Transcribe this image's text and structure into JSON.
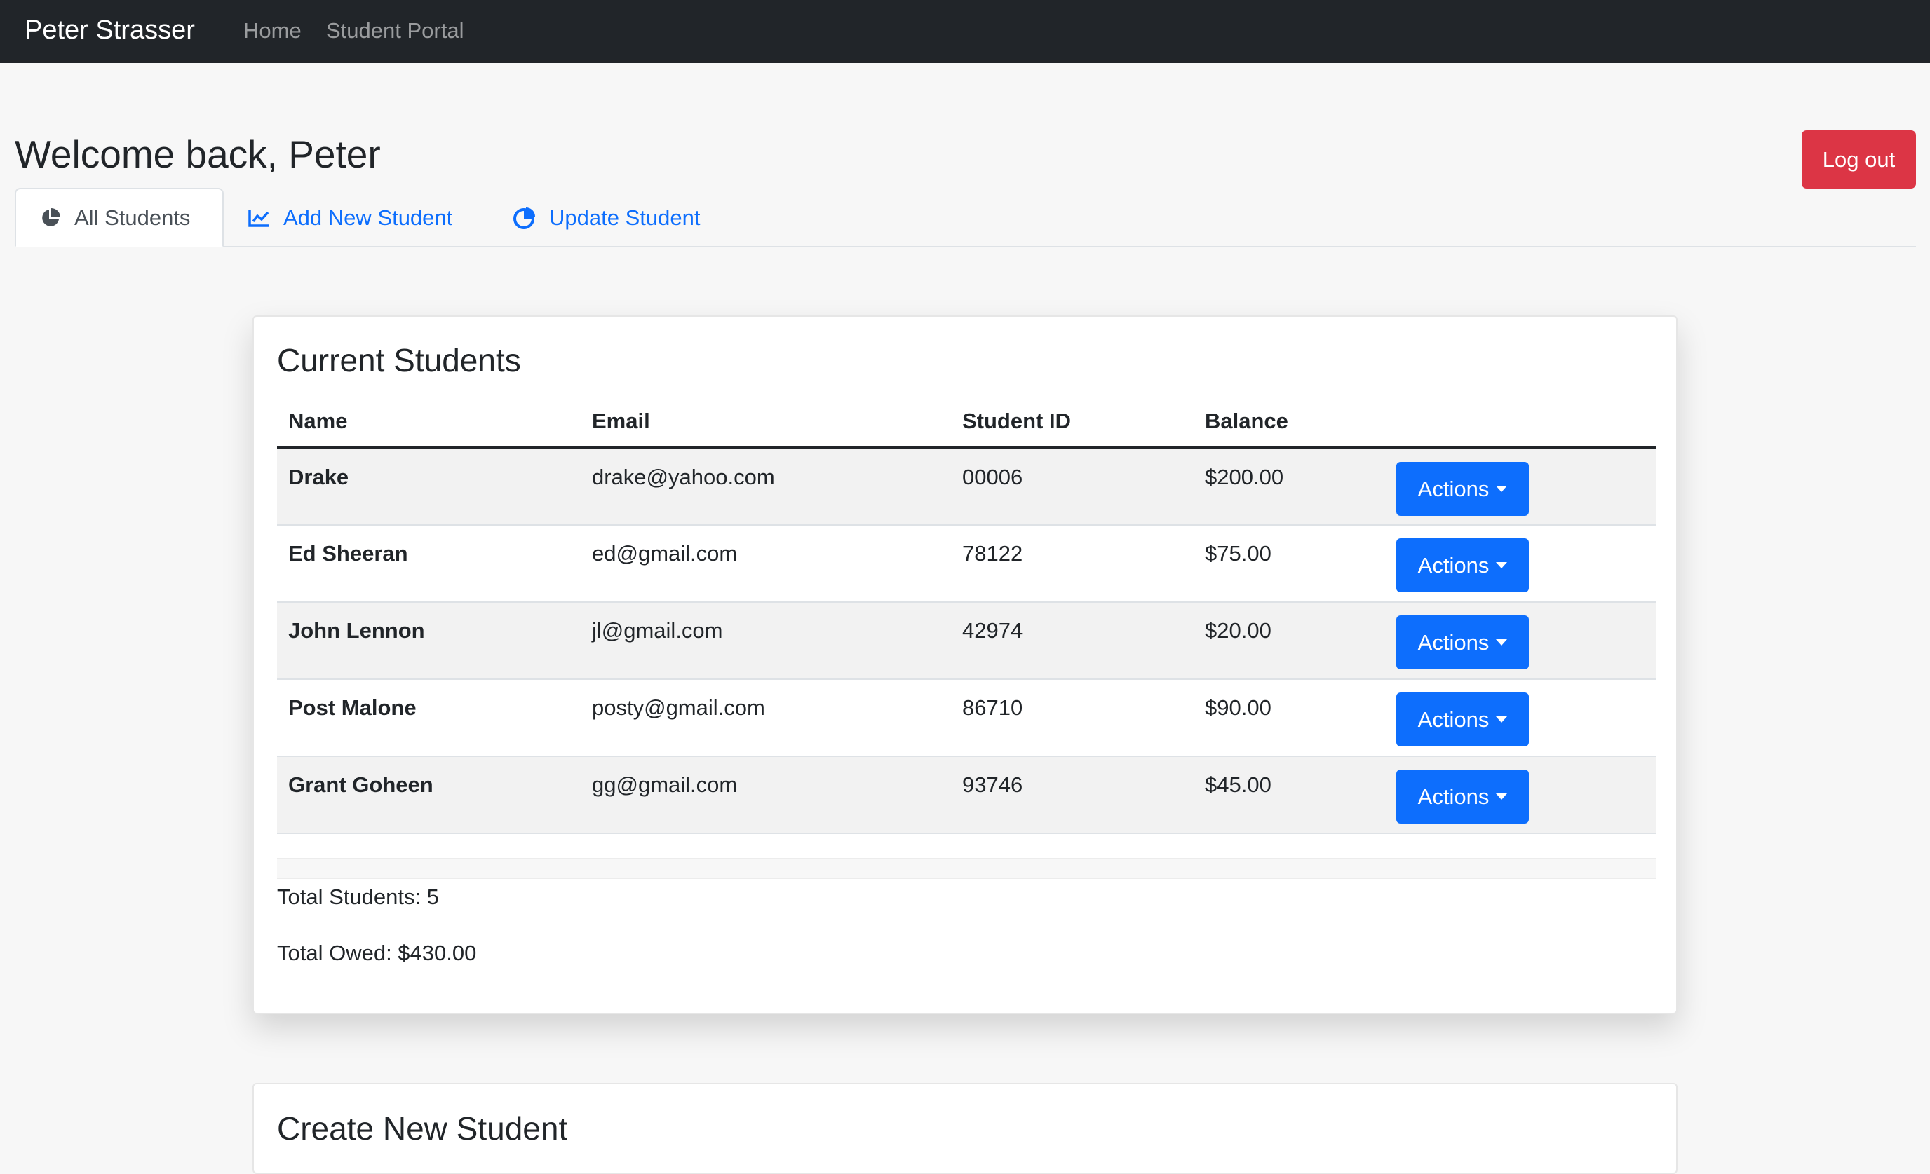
{
  "navbar": {
    "brand": "Peter Strasser",
    "links": [
      "Home",
      "Student Portal"
    ]
  },
  "header": {
    "welcome": "Welcome back, Peter",
    "logout_label": "Log out"
  },
  "tabs": [
    {
      "label": "All Students",
      "icon": "pie-chart-icon",
      "active": true
    },
    {
      "label": "Add New Student",
      "icon": "line-chart-icon",
      "active": false
    },
    {
      "label": "Update Student",
      "icon": "pie-chart-icon",
      "active": false
    }
  ],
  "students_card": {
    "title": "Current Students",
    "columns": [
      "Name",
      "Email",
      "Student ID",
      "Balance"
    ],
    "rows": [
      {
        "name": "Drake",
        "email": "drake@yahoo.com",
        "id": "00006",
        "balance": "$200.00",
        "action": "Actions"
      },
      {
        "name": "Ed Sheeran",
        "email": "ed@gmail.com",
        "id": "78122",
        "balance": "$75.00",
        "action": "Actions"
      },
      {
        "name": "John Lennon",
        "email": "jl@gmail.com",
        "id": "42974",
        "balance": "$20.00",
        "action": "Actions"
      },
      {
        "name": "Post Malone",
        "email": "posty@gmail.com",
        "id": "86710",
        "balance": "$90.00",
        "action": "Actions"
      },
      {
        "name": "Grant Goheen",
        "email": "gg@gmail.com",
        "id": "93746",
        "balance": "$45.00",
        "action": "Actions"
      }
    ],
    "total_students": "Total Students: 5",
    "total_owed": "Total Owed: $430.00"
  },
  "create_card": {
    "title": "Create New Student"
  },
  "colors": {
    "navbar": "#212529",
    "primary": "#0d6efd",
    "danger": "#dc3545"
  }
}
